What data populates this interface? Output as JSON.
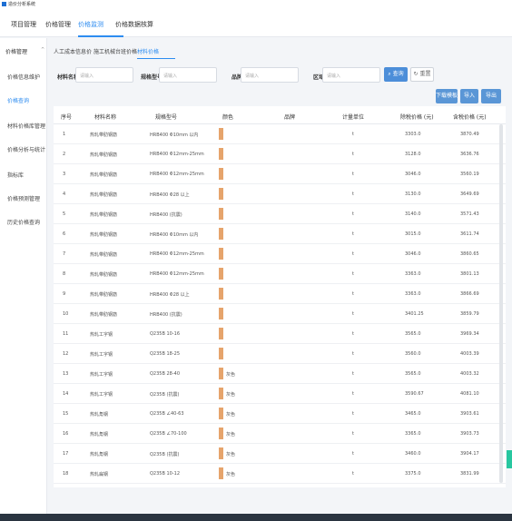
{
  "window_title": "造价分析系统",
  "top_nav": [
    "项目管理",
    "价格管理",
    "价格监测",
    "价格数据核算"
  ],
  "sidebar": {
    "group": "价格管理",
    "items": [
      "价格信息维护",
      "价格查询",
      "材料价格库管理",
      "价格分析与统计",
      "指标库",
      "价格预测管理",
      "历史价格查询"
    ]
  },
  "subtabs": [
    "人工成本信息价",
    "施工机械台班价格",
    "材料价格"
  ],
  "filters": {
    "material_name": {
      "label": "材料名称",
      "placeholder": "请输入"
    },
    "spec": {
      "label": "规格型号",
      "placeholder": "请输入"
    },
    "brand": {
      "label": "品牌",
      "placeholder": "请输入"
    },
    "region": {
      "label": "区域",
      "placeholder": "请输入"
    },
    "search_btn": "查询",
    "reset_btn": "重置"
  },
  "actions": {
    "batch": "下载模板",
    "import": "导入",
    "export": "导出"
  },
  "columns": [
    "序号",
    "材料名称",
    "规格型号",
    "颜色",
    "品牌",
    "计量单位",
    "除税价格 (元)",
    "含税价格 (元)"
  ],
  "rows": [
    {
      "no": "1",
      "name": "热轧带肋钢筋",
      "spec": "HRB400 Φ10mm 以内",
      "color": "",
      "unit": "t",
      "price_ex": "3303.0",
      "price_in": "3870.49"
    },
    {
      "no": "2",
      "name": "热轧带肋钢筋",
      "spec": "HRB400 Φ12mm-25mm",
      "color": "",
      "unit": "t",
      "price_ex": "3128.0",
      "price_in": "3636.76"
    },
    {
      "no": "3",
      "name": "热轧带肋钢筋",
      "spec": "HRB400 Φ12mm-25mm",
      "color": "",
      "unit": "t",
      "price_ex": "3046.0",
      "price_in": "3560.19"
    },
    {
      "no": "4",
      "name": "热轧带肋钢筋",
      "spec": "HRB400 Φ28 以上",
      "color": "",
      "unit": "t",
      "price_ex": "3130.0",
      "price_in": "3649.69"
    },
    {
      "no": "5",
      "name": "热轧带肋钢筋",
      "spec": "HRB400 (抗震)",
      "color": "",
      "unit": "t",
      "price_ex": "3140.0",
      "price_in": "3571.43"
    },
    {
      "no": "6",
      "name": "热轧带肋钢筋",
      "spec": "HRB400 Φ10mm 以内",
      "color": "",
      "unit": "t",
      "price_ex": "3015.0",
      "price_in": "3611.74"
    },
    {
      "no": "7",
      "name": "热轧带肋钢筋",
      "spec": "HRB400 Φ12mm-25mm",
      "color": "",
      "unit": "t",
      "price_ex": "3046.0",
      "price_in": "3860.65"
    },
    {
      "no": "8",
      "name": "热轧带肋钢筋",
      "spec": "HRB400 Φ12mm-25mm",
      "color": "",
      "unit": "t",
      "price_ex": "3363.0",
      "price_in": "3801.13"
    },
    {
      "no": "9",
      "name": "热轧带肋钢筋",
      "spec": "HRB400 Φ28 以上",
      "color": "",
      "unit": "t",
      "price_ex": "3363.0",
      "price_in": "3866.69"
    },
    {
      "no": "10",
      "name": "热轧带肋钢筋",
      "spec": "HRB400 (抗震)",
      "color": "",
      "unit": "t",
      "price_ex": "3401.25",
      "price_in": "3859.79"
    },
    {
      "no": "11",
      "name": "热轧工字钢",
      "spec": "Q235B 10-16",
      "color": "",
      "unit": "t",
      "price_ex": "3565.0",
      "price_in": "3969.34"
    },
    {
      "no": "12",
      "name": "热轧工字钢",
      "spec": "Q235B 18-25",
      "color": "",
      "unit": "t",
      "price_ex": "3560.0",
      "price_in": "4003.39"
    },
    {
      "no": "13",
      "name": "热轧工字钢",
      "spec": "Q235B 28-40",
      "color": "灰色",
      "unit": "t",
      "price_ex": "3565.0",
      "price_in": "4003.32"
    },
    {
      "no": "14",
      "name": "热轧工字钢",
      "spec": "Q235B (抗震)",
      "color": "灰色",
      "unit": "t",
      "price_ex": "3590.67",
      "price_in": "4081.10"
    },
    {
      "no": "15",
      "name": "热轧角钢",
      "spec": "Q235B ∠40-63",
      "color": "灰色",
      "unit": "t",
      "price_ex": "3465.0",
      "price_in": "3903.61"
    },
    {
      "no": "16",
      "name": "热轧角钢",
      "spec": "Q235B ∠70-100",
      "color": "灰色",
      "unit": "t",
      "price_ex": "3365.0",
      "price_in": "3903.73"
    },
    {
      "no": "17",
      "name": "热轧角钢",
      "spec": "Q235B (抗震)",
      "color": "灰色",
      "unit": "t",
      "price_ex": "3460.0",
      "price_in": "3904.17"
    },
    {
      "no": "18",
      "name": "热轧扁钢",
      "spec": "Q235B 10-12",
      "color": "灰色",
      "unit": "t",
      "price_ex": "3375.0",
      "price_in": "3831.99"
    }
  ],
  "colors": {
    "accent": "#2d8cf0",
    "swatch": "#e6a46c",
    "float": "#28c7a0"
  }
}
